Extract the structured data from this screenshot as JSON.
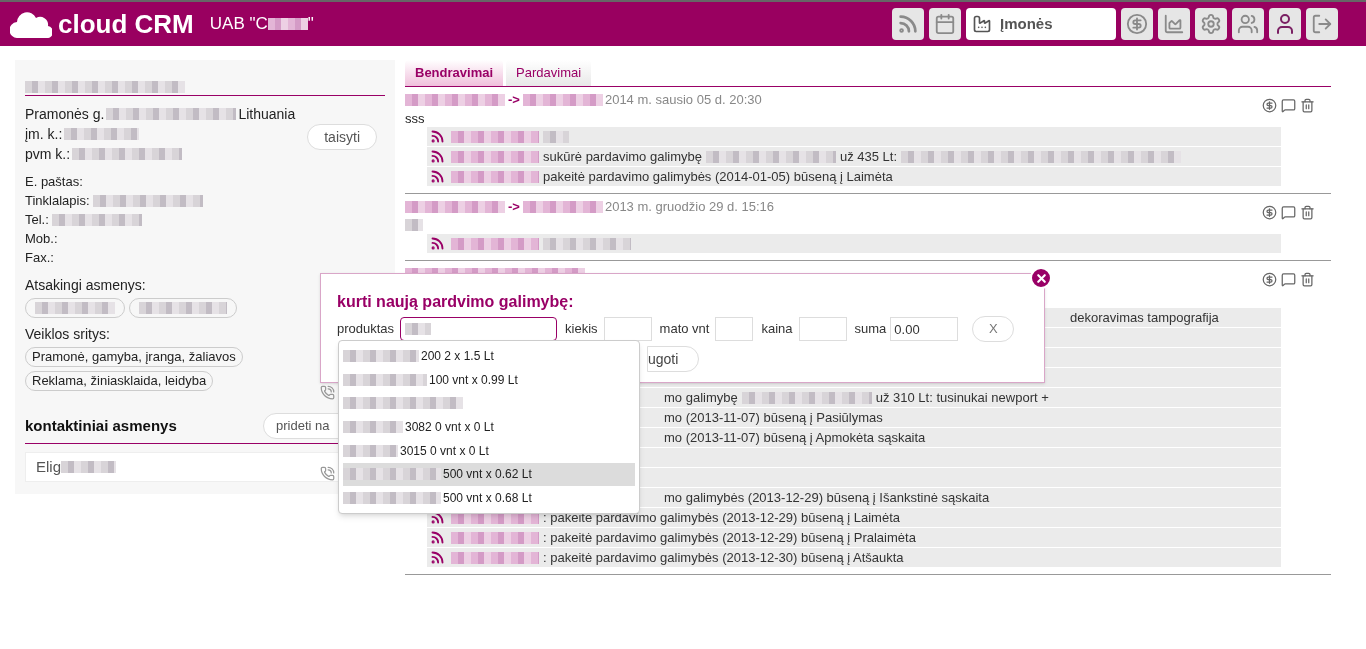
{
  "header": {
    "logo": "cloud CRM",
    "company_prefix": "UAB \"C",
    "company_suffix": "\"",
    "module_select": "Įmonės"
  },
  "company": {
    "address_prefix": "Pramonės g.",
    "address_suffix": "Lithuania",
    "code_label": "įm. k.:",
    "vat_label": "pvm k.:",
    "edit_button": "taisyti",
    "fields": [
      {
        "label": "E. paštas:",
        "value_hidden": false
      },
      {
        "label": "Tinklalapis:",
        "value_hidden": true
      },
      {
        "label": "Tel.:",
        "value_hidden": true
      },
      {
        "label": "Mob.:",
        "value_hidden": false
      },
      {
        "label": "Fax.:",
        "value_hidden": false
      }
    ],
    "responsible_label": "Atsakingi asmenys:",
    "areas_label": "Veiklos sritys:",
    "areas": [
      "Pramonė, gamyba, įranga, žaliavos",
      "Reklama, žiniasklaida, leidyba"
    ]
  },
  "contacts": {
    "title": "kontaktiniai asmenys",
    "add_button": "prideti na",
    "items": [
      {
        "name_prefix": "Elig"
      }
    ]
  },
  "tabs": [
    {
      "label": "Bendravimai",
      "selected": true
    },
    {
      "label": "Pardavimai",
      "selected": false
    }
  ],
  "entries": [
    {
      "arrow": "->",
      "date": "2014 m. sausio 05 d. 20:30",
      "message": "sss",
      "rows": [
        {
          "kind": "full",
          "parts": [
            {
              "kind": "hidden_name"
            },
            {
              "kind": "hidden_short"
            }
          ]
        },
        {
          "kind": "full",
          "parts": [
            {
              "kind": "hidden_name"
            },
            {
              "kind": "text",
              "text": "sukūrė pardavimo galimybę"
            },
            {
              "kind": "hidden_long"
            },
            {
              "kind": "text",
              "text": "už 435 Lt:"
            },
            {
              "kind": "hidden_xlong"
            }
          ]
        },
        {
          "kind": "full",
          "parts": [
            {
              "kind": "hidden_name"
            },
            {
              "kind": "text",
              "text": "pakeitė pardavimo galimybės (2014-01-05) būseną į Laimėta"
            }
          ]
        }
      ]
    },
    {
      "arrow": "->",
      "date": "2013 m. gruodžio 29 d. 15:16",
      "rows": [
        {
          "kind": "full",
          "parts": [
            {
              "kind": "hidden_name"
            },
            {
              "kind": "hidden_name"
            }
          ]
        }
      ]
    },
    {
      "rows": [
        {
          "kind": "dialog_cut",
          "parts": [
            {
              "kind": "text",
              "text": "dekoravimas tampografija"
            }
          ]
        },
        {
          "kind": "dialog_cut",
          "parts": []
        },
        {
          "kind": "dialog_cut",
          "parts": []
        },
        {
          "kind": "dialog_cut",
          "parts": []
        },
        {
          "kind": "menu_cut",
          "parts": [
            {
              "kind": "text",
              "text": "mo galimybę"
            },
            {
              "kind": "hidden_long"
            },
            {
              "kind": "text",
              "text": "už 310 Lt: tusinukai newport +"
            }
          ]
        },
        {
          "kind": "menu_cut",
          "parts": [
            {
              "kind": "text",
              "text": "mo (2013-11-07) būseną į Pasiūlymas"
            }
          ]
        },
        {
          "kind": "menu_cut",
          "parts": [
            {
              "kind": "text",
              "text": "mo (2013-11-07) būseną į Apmokėta sąskaita"
            }
          ]
        },
        {
          "kind": "menu_cut",
          "parts": []
        },
        {
          "kind": "menu_cut",
          "parts": []
        },
        {
          "kind": "menu_cut",
          "parts": [
            {
              "kind": "text",
              "text": "mo galimybės (2013-12-29) būseną į Išankstinė sąskaita"
            }
          ]
        },
        {
          "kind": "full",
          "parts": [
            {
              "kind": "hidden_name"
            },
            {
              "kind": "text",
              "text": ": pakeitė pardavimo galimybės (2013-12-29) būseną į Laimėta"
            }
          ]
        },
        {
          "kind": "full",
          "parts": [
            {
              "kind": "hidden_name"
            },
            {
              "kind": "text",
              "text": ": pakeitė pardavimo galimybės (2013-12-29) būseną į Pralaimėta"
            }
          ]
        },
        {
          "kind": "full",
          "parts": [
            {
              "kind": "hidden_name"
            },
            {
              "kind": "text",
              "text": ": pakeitė pardavimo galimybės (2013-12-30) būseną į Atšaukta"
            }
          ]
        }
      ]
    }
  ],
  "dialog": {
    "title": "kurti naują pardvimo galimybę:",
    "product_label": "produktas",
    "quantity_label": "kiekis",
    "unit_label": "mato vnt",
    "price_label": "kaina",
    "sum_label": "suma",
    "sum_value": "0.00",
    "remove_button": "X",
    "save_button": "ugoti",
    "suggestions": [
      {
        "text": "200 2 x 1.5 Lt",
        "selected": false
      },
      {
        "text": "100 vnt x 0.99 Lt",
        "selected": false
      },
      {
        "selected": false
      },
      {
        "text": "3082 0 vnt x 0 Lt",
        "selected": false
      },
      {
        "text": "3015 0 vnt x 0 Lt",
        "selected": false
      },
      {
        "text": "500 vnt x 0.62 Lt",
        "selected": true
      },
      {
        "text": "500 vnt x 0.68 Lt",
        "selected": false
      }
    ]
  }
}
